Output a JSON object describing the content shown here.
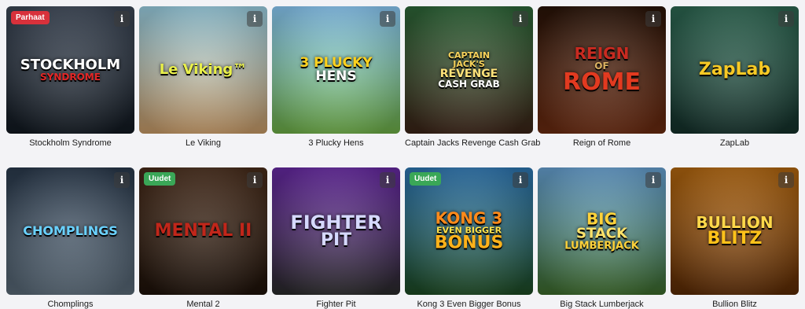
{
  "games": [
    {
      "title": "Stockholm Syndrome",
      "badge": "Parhaat",
      "badge_type": "top",
      "info": "i",
      "logo_lines": [
        "STOCKHOLM",
        "SYNDROME"
      ],
      "logo_colors": [
        "#ffffff",
        "#e32626"
      ],
      "bg": [
        "#3f4a5a",
        "#111820"
      ]
    },
    {
      "title": "Le Viking",
      "badge": "",
      "badge_type": "",
      "info": "i",
      "logo_lines": [
        "Le Viking™"
      ],
      "logo_colors": [
        "#e9f04a"
      ],
      "bg": [
        "#9fd6ea",
        "#c89a66"
      ]
    },
    {
      "title": "3 Plucky Hens",
      "badge": "",
      "badge_type": "",
      "info": "i",
      "logo_lines": [
        "3 PLUCKY",
        "HENS"
      ],
      "logo_colors": [
        "#ffd21e",
        "#ffffff"
      ],
      "bg": [
        "#8fd0ff",
        "#6dae45"
      ]
    },
    {
      "title": "Captain Jacks Revenge Cash Grab",
      "badge": "",
      "badge_type": "",
      "info": "i",
      "logo_lines": [
        "CAPTAIN",
        "JACK'S",
        "REVENGE",
        "CASH GRAB"
      ],
      "logo_colors": [
        "#f7d25a",
        "#f7d25a",
        "#ffe37a",
        "#ffffff"
      ],
      "bg": [
        "#2f6a3a",
        "#3b2317"
      ]
    },
    {
      "title": "Reign of Rome",
      "badge": "",
      "badge_type": "",
      "info": "i",
      "logo_lines": [
        "REIGN",
        "OF",
        "ROME"
      ],
      "logo_colors": [
        "#c92a20",
        "#d9b060",
        "#e23a20"
      ],
      "bg": [
        "#2a1408",
        "#6a2a10"
      ]
    },
    {
      "title": "ZapLab",
      "badge": "",
      "badge_type": "",
      "info": "i",
      "logo_lines": [
        "ZapLab"
      ],
      "logo_colors": [
        "#f6c925"
      ],
      "bg": [
        "#2f6b55",
        "#14302a"
      ]
    },
    {
      "title": "Chomplings",
      "badge": "",
      "badge_type": "",
      "info": "i",
      "logo_lines": [
        "CHOMPLINGS"
      ],
      "logo_colors": [
        "#6ad1ff"
      ],
      "bg": [
        "#2b3b4e",
        "#5a6a78"
      ]
    },
    {
      "title": "Mental 2",
      "badge": "Uudet",
      "badge_type": "new",
      "info": "i",
      "logo_lines": [
        "MENTAL II"
      ],
      "logo_colors": [
        "#c1261a"
      ],
      "bg": [
        "#4a2e1c",
        "#1e120a"
      ]
    },
    {
      "title": "Fighter Pit",
      "badge": "",
      "badge_type": "",
      "info": "i",
      "logo_lines": [
        "FIGHTER",
        "PIT"
      ],
      "logo_colors": [
        "#d6d9ff",
        "#d6d9ff"
      ],
      "bg": [
        "#6a2aa8",
        "#2a2a2a"
      ]
    },
    {
      "title": "Kong 3 Even Bigger Bonus",
      "badge": "Uudet",
      "badge_type": "new",
      "info": "i",
      "logo_lines": [
        "KONG 3",
        "EVEN BIGGER",
        "BONUS"
      ],
      "logo_colors": [
        "#ff8a1a",
        "#ffe14a",
        "#ffb21a"
      ],
      "bg": [
        "#2f7ab8",
        "#1d4a22"
      ]
    },
    {
      "title": "Big Stack Lumberjack",
      "badge": "",
      "badge_type": "",
      "info": "i",
      "logo_lines": [
        "BIG",
        "STACK",
        "LUMBERJACK"
      ],
      "logo_colors": [
        "#ffd23a",
        "#ffe36a",
        "#ffd23a"
      ],
      "bg": [
        "#6aa6d9",
        "#3c6a2a"
      ]
    },
    {
      "title": "Bullion Blitz",
      "badge": "",
      "badge_type": "",
      "info": "i",
      "logo_lines": [
        "BULLION",
        "BLITZ"
      ],
      "logo_colors": [
        "#ffd84a",
        "#ffc21a"
      ],
      "bg": [
        "#b86a10",
        "#5a2a05"
      ]
    }
  ]
}
